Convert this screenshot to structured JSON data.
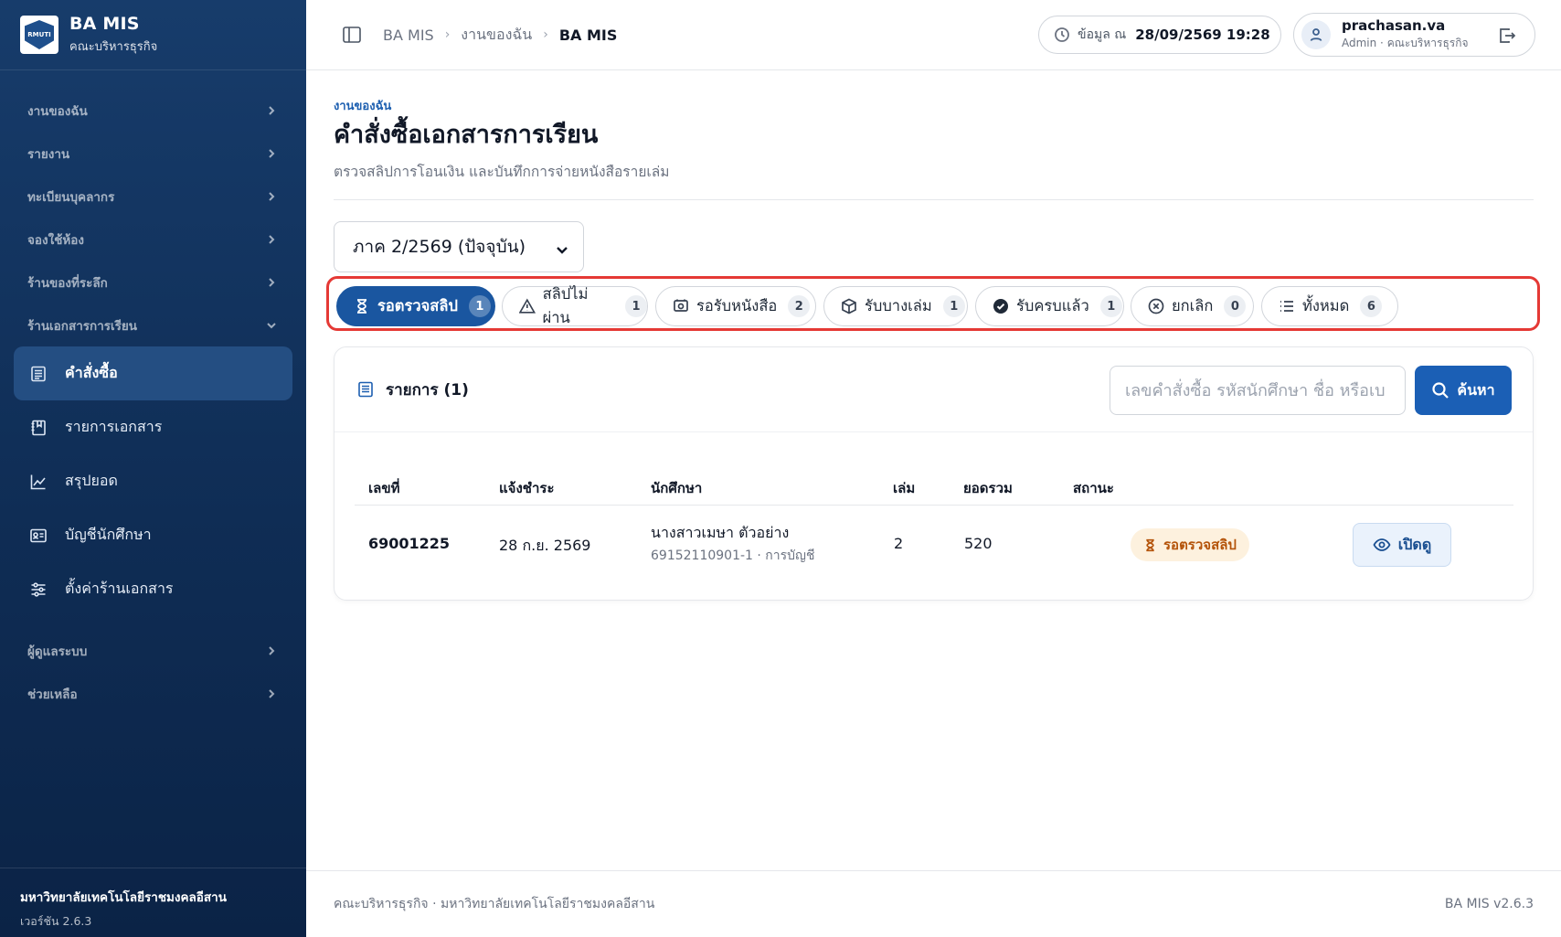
{
  "brand": {
    "title": "BA MIS",
    "subtitle": "คณะบริหารธุรกิจ",
    "logo_text": "RMUTI"
  },
  "sidebar": {
    "groups_top": [
      {
        "label": "งานของฉัน"
      },
      {
        "label": "รายงาน"
      },
      {
        "label": "ทะเบียนบุคลากร"
      },
      {
        "label": "จองใช้ห้อง"
      },
      {
        "label": "ร้านของที่ระลึก"
      },
      {
        "label": "ร้านเอกสารการเรียน"
      }
    ],
    "sub_items": [
      {
        "label": "คำสั่งซื้อ",
        "icon": "receipt-icon",
        "active": true
      },
      {
        "label": "รายการเอกสาร",
        "icon": "book-icon"
      },
      {
        "label": "สรุปยอด",
        "icon": "chart-line-icon"
      },
      {
        "label": "บัญชีนักศึกษา",
        "icon": "id-card-icon"
      },
      {
        "label": "ตั้งค่าร้านเอกสาร",
        "icon": "sliders-icon"
      }
    ],
    "groups_bottom": [
      {
        "label": "ผู้ดูแลระบบ"
      },
      {
        "label": "ช่วยเหลือ"
      }
    ],
    "footer": {
      "org": "มหาวิทยาลัยเทคโนโลยีราชมงคลอีสาน",
      "version": "เวอร์ชัน 2.6.3"
    }
  },
  "topbar": {
    "breadcrumb": [
      "BA MIS",
      "งานของฉัน",
      "BA MIS"
    ],
    "data_label": "ข้อมูล ณ",
    "data_time": "28/09/2569 19:28",
    "user": {
      "name": "prachasan.va",
      "role": "Admin · คณะบริหารธุรกิจ"
    }
  },
  "page": {
    "eyebrow": "งานของฉัน",
    "title": "คำสั่งซื้อเอกสารการเรียน",
    "subtitle": "ตรวจสลิปการโอนเงิน และบันทึกการจ่ายหนังสือรายเล่ม",
    "term_select": "ภาค 2/2569 (ปัจจุบัน)"
  },
  "tabs": [
    {
      "label": "รอตรวจสลิป",
      "count": "1",
      "icon": "hourglass-icon",
      "active": true
    },
    {
      "label": "สลิปไม่ผ่าน",
      "count": "1",
      "icon": "warning-icon"
    },
    {
      "label": "รอรับหนังสือ",
      "count": "2",
      "icon": "pickup-icon"
    },
    {
      "label": "รับบางเล่ม",
      "count": "1",
      "icon": "box-icon"
    },
    {
      "label": "รับครบแล้ว",
      "count": "1",
      "icon": "check-circle-icon"
    },
    {
      "label": "ยกเลิก",
      "count": "0",
      "icon": "x-circle-icon"
    },
    {
      "label": "ทั้งหมด",
      "count": "6",
      "icon": "list-icon"
    }
  ],
  "list": {
    "title": "รายการ (1)",
    "search_placeholder": "เลขคำสั่งซื้อ รหัสนักศึกษา ชื่อ หรือเบ",
    "search_button": "ค้นหา",
    "columns": [
      "เลขที่",
      "แจ้งชำระ",
      "นักศึกษา",
      "เล่ม",
      "ยอดรวม",
      "สถานะ"
    ],
    "rows": [
      {
        "order_no": "69001225",
        "paid_date": "28 ก.ย. 2569",
        "student_name": "นางสาวเมษา ตัวอย่าง",
        "student_meta": "69152110901-1 · การบัญชี",
        "books": "2",
        "total": "520",
        "status": "รอตรวจสลิป",
        "action": "เปิดดู"
      }
    ]
  },
  "footer": {
    "left": "คณะบริหารธุรกิจ · มหาวิทยาลัยเทคโนโลยีราชมงคลอีสาน",
    "right": "BA MIS v2.6.3"
  }
}
